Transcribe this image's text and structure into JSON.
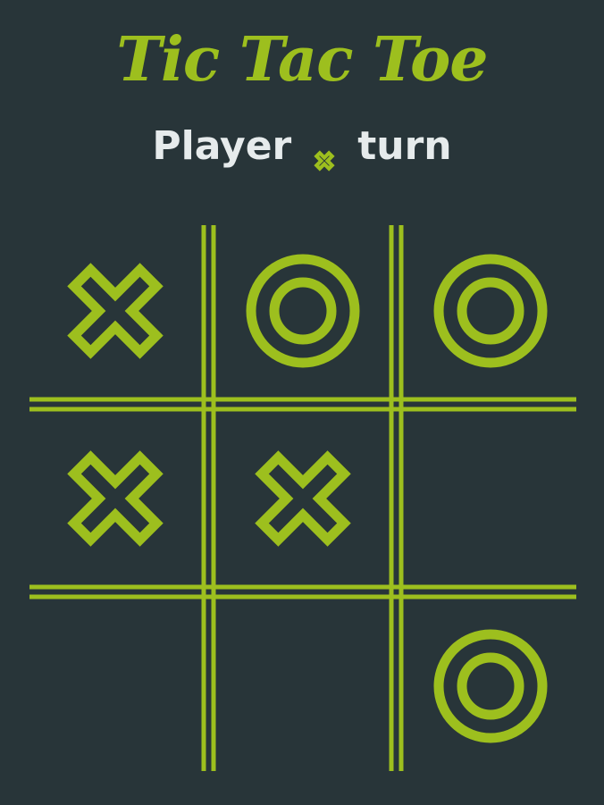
{
  "header": {
    "title": "Tic Tac Toe"
  },
  "status": {
    "prefix": "Player",
    "current_player": "X",
    "suffix": "turn"
  },
  "board": {
    "cells": [
      "X",
      "O",
      "O",
      "X",
      "X",
      "",
      "",
      "",
      "O"
    ]
  },
  "colors": {
    "background": "#283539",
    "accent": "#9dbf1e",
    "text": "#e6ebec"
  },
  "icons": {
    "x_mark": "x-mark-icon",
    "o_mark": "o-mark-icon"
  }
}
